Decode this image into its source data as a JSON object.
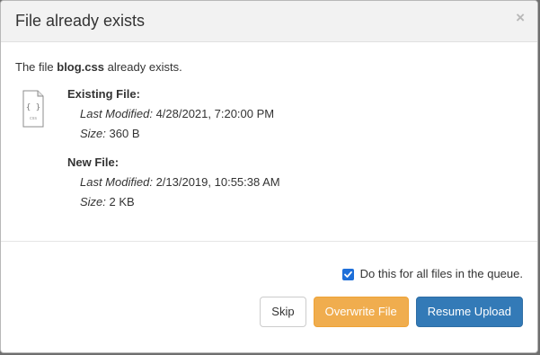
{
  "dialog": {
    "title": "File already exists",
    "close_label": "×"
  },
  "message": {
    "prefix": "The file ",
    "filename": "blog.css",
    "suffix": " already exists."
  },
  "file_icon": {
    "name": "css-file-icon",
    "label": "css",
    "glyph": "{ }"
  },
  "existing_file": {
    "title": "Existing File:",
    "last_modified_label": "Last Modified:",
    "last_modified_value": "4/28/2021, 7:20:00 PM",
    "size_label": "Size:",
    "size_value": "360 B"
  },
  "new_file": {
    "title": "New File:",
    "last_modified_label": "Last Modified:",
    "last_modified_value": "2/13/2019, 10:55:38 AM",
    "size_label": "Size:",
    "size_value": "2 KB"
  },
  "options": {
    "apply_all_label": "Do this for all files in the queue.",
    "apply_all_checked": true
  },
  "buttons": {
    "skip": "Skip",
    "overwrite": "Overwrite File",
    "resume": "Resume Upload"
  },
  "colors": {
    "overwrite": "#f0ad4e",
    "resume": "#337ab7",
    "checkbox": "#1e6fd9"
  }
}
